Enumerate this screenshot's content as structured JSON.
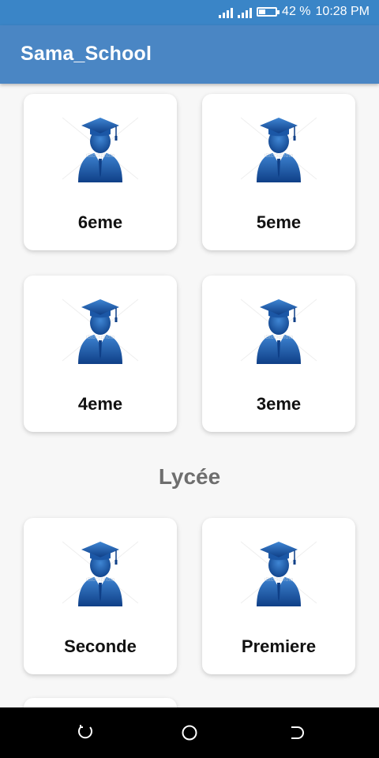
{
  "status_bar": {
    "battery": "42 %",
    "time": "10:28 PM",
    "battery_level": 0.42
  },
  "app": {
    "title": "Sama_School"
  },
  "grades_top": [
    {
      "label": "6eme"
    },
    {
      "label": "5eme"
    },
    {
      "label": "4eme"
    },
    {
      "label": "3eme"
    }
  ],
  "lycee": {
    "title": "Lycée",
    "grades": [
      {
        "label": "Seconde"
      },
      {
        "label": "Premiere"
      }
    ]
  },
  "colors": {
    "status_bar": "#3a85c7",
    "app_bar": "#4a86c4",
    "graduate_blue": "#1b57a6",
    "background": "#f7f7f7"
  },
  "icons": {
    "card": "graduate-icon",
    "nav_back": "back-icon",
    "nav_home": "home-icon",
    "nav_recent": "recent-apps-icon"
  }
}
